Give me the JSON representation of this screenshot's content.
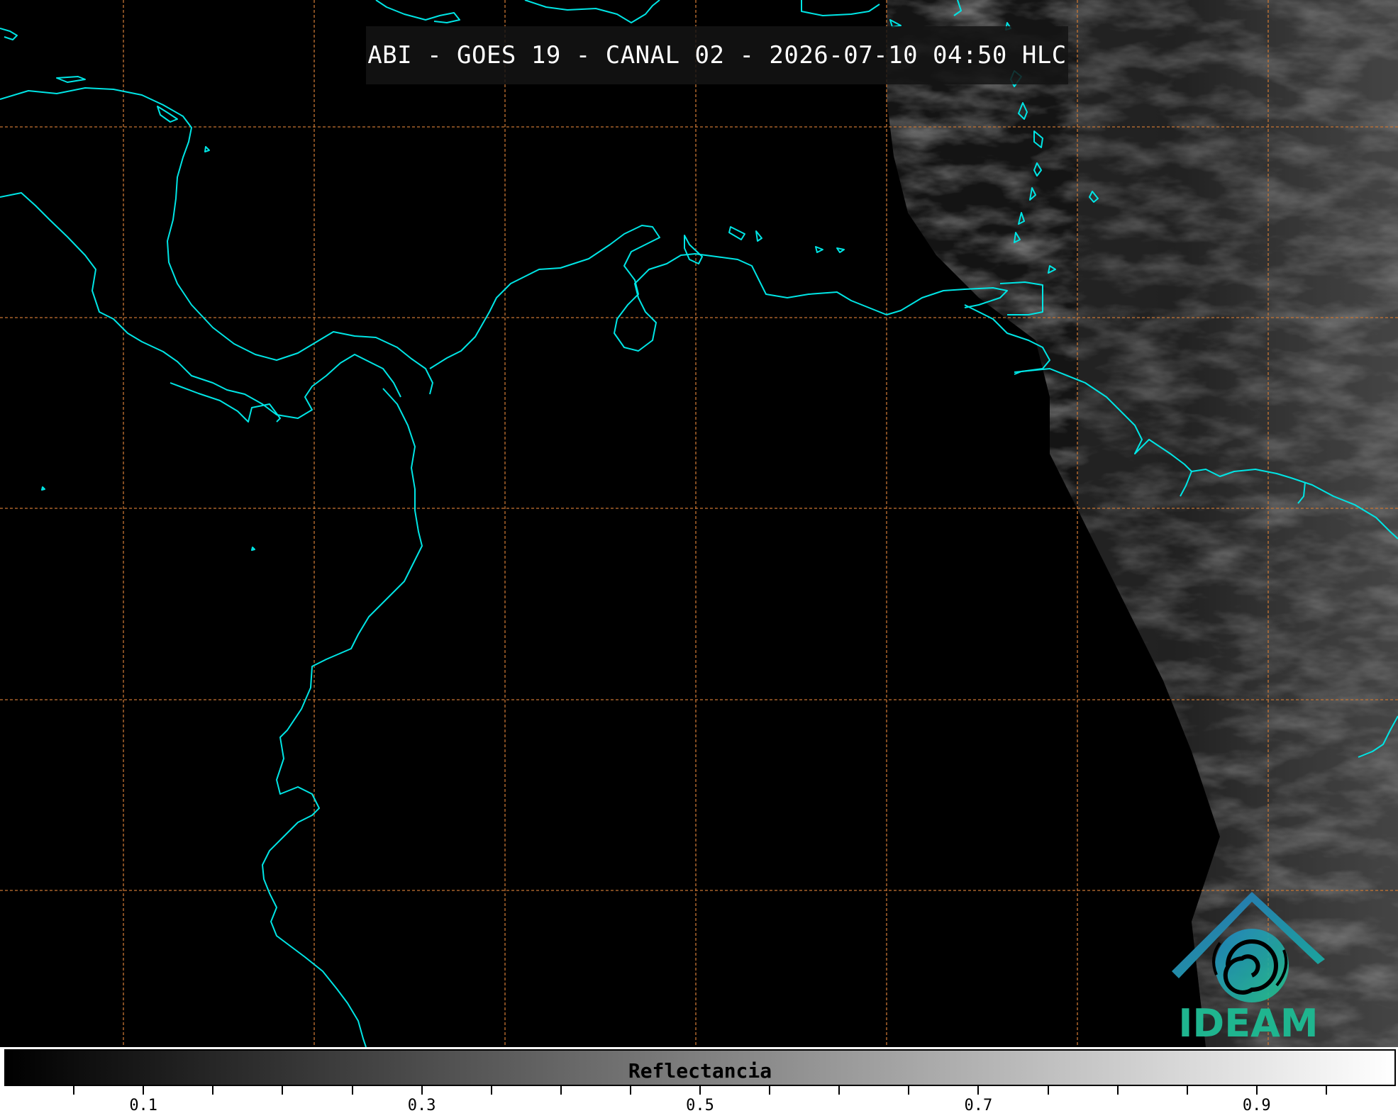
{
  "title": "ABI - GOES 19 - CANAL 02 - 2026-07-10 04:50 HLC",
  "colorbar": {
    "label": "Reflectancia",
    "ticks": [
      "0.1",
      "0.3",
      "0.5",
      "0.7",
      "0.9"
    ],
    "range": [
      0.0,
      1.0
    ],
    "gradient_from": "#000000",
    "gradient_to": "#ffffff"
  },
  "logo": {
    "text": "IDEAM",
    "icon": "ideam-logo-icon"
  },
  "colors": {
    "coastline": "#00e5e5",
    "gridline": "#c87533",
    "background": "#000000"
  },
  "map": {
    "grid": "dashed graticule",
    "content": "visible reflectance imagery"
  }
}
